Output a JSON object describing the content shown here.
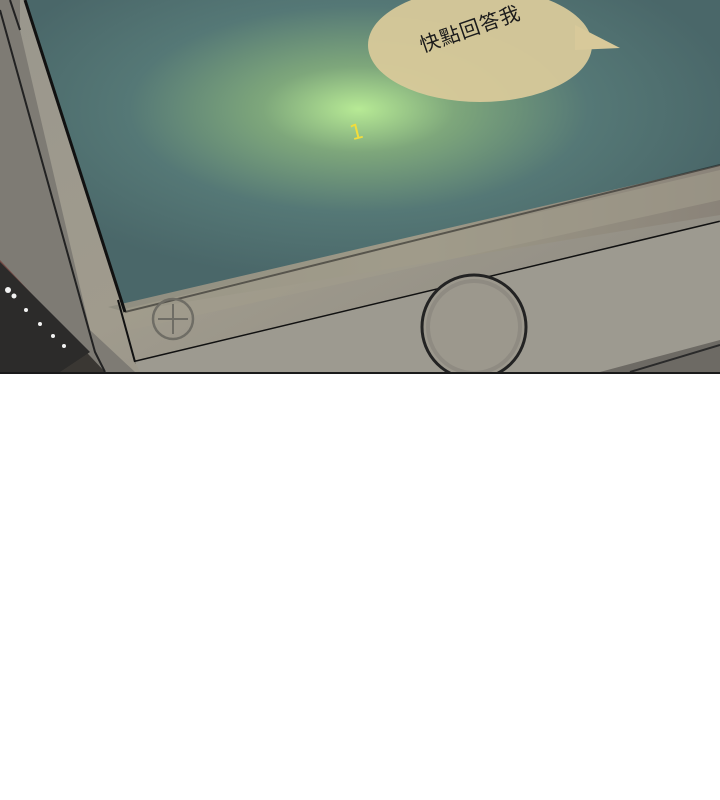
{
  "speech_bubble": {
    "text": "快點回答我"
  },
  "notification": {
    "count_text": "1"
  },
  "colors": {
    "screen_teal": "#4f7072",
    "glow_green": "#a6e08a",
    "phone_bezel": "#8d8981",
    "bubble_fill": "#d8c99a",
    "badge_yellow": "#f2dd3b"
  },
  "icons": [
    "plus-icon",
    "home-button-icon"
  ]
}
